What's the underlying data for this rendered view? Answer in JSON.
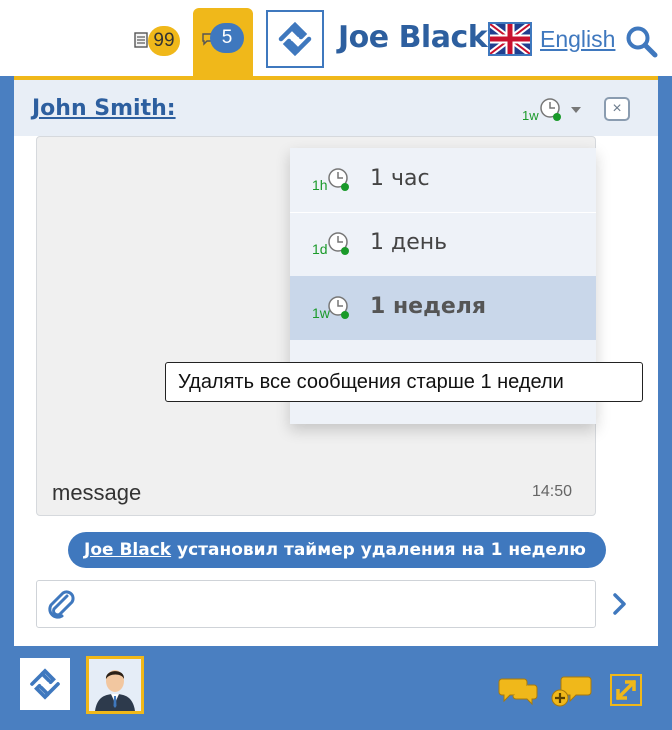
{
  "header": {
    "notes_badge": "99",
    "chats_badge": "5",
    "user_name": "Joe Black",
    "language": "English"
  },
  "chat": {
    "contact_name": "John Smith:",
    "timer_selected_icon": "1w",
    "close_label": "×"
  },
  "timer_menu": {
    "items": [
      {
        "icon": "1h",
        "label": "1 час",
        "selected": false
      },
      {
        "icon": "1d",
        "label": "1 день",
        "selected": false
      },
      {
        "icon": "1w",
        "label": "1 неделя",
        "selected": true
      }
    ],
    "tooltip": "Удалять все сообщения старше 1 недели"
  },
  "messages": [
    {
      "text": "message",
      "time": "14:50"
    }
  ],
  "system_message": {
    "actor": "Joe Black",
    "text": " установил таймер удаления на 1 неделю"
  },
  "input": {
    "value": "",
    "placeholder": ""
  },
  "colors": {
    "accent_blue": "#4a7fc1",
    "accent_yellow": "#f0b81a",
    "timer_green": "#1a9a2a"
  },
  "icons": {
    "notes": "notes-icon",
    "chat": "chat-bubble-icon",
    "logo": "app-logo-icon",
    "flag": "uk-flag-icon",
    "search": "search-icon",
    "timer": "clock-timer-icon",
    "close": "close-icon",
    "attach": "paperclip-icon",
    "send": "chevron-right-icon",
    "chats": "chats-icon",
    "new_chat": "new-chat-icon",
    "expand": "expand-icon"
  }
}
